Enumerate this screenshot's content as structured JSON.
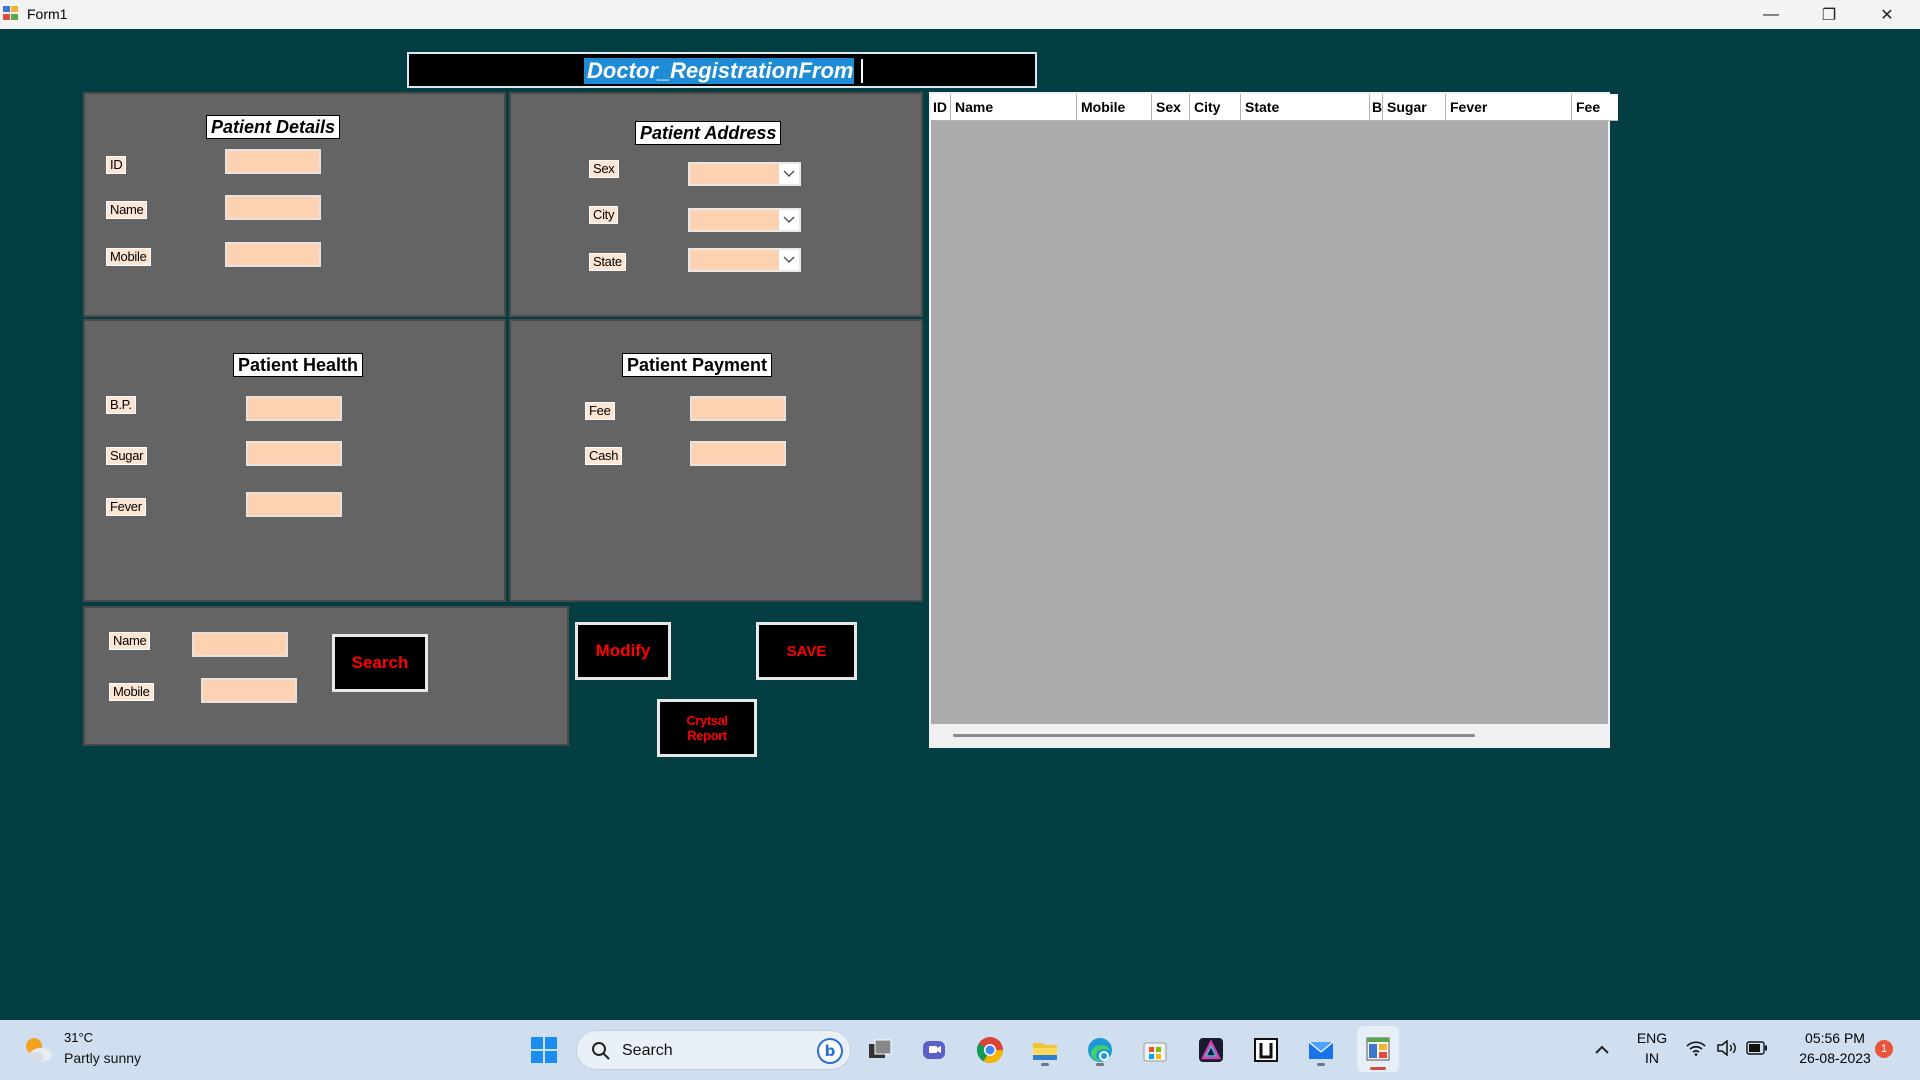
{
  "window": {
    "title": "Form1",
    "minimize": "—",
    "restore": "❐",
    "close": "✕"
  },
  "form": {
    "heading": "Doctor_RegistrationFrom"
  },
  "patient_details": {
    "title": "Patient Details",
    "id_label": "ID",
    "name_label": "Name",
    "mobile_label": "Mobile"
  },
  "patient_address": {
    "title": "Patient Address",
    "sex_label": "Sex",
    "city_label": "City",
    "state_label": "State"
  },
  "patient_health": {
    "title": "Patient Health",
    "bp_label": "B.P.",
    "sugar_label": "Sugar",
    "fever_label": "Fever"
  },
  "patient_payment": {
    "title": "Patient Payment",
    "fee_label": "Fee",
    "cash_label": "Cash"
  },
  "search_panel": {
    "name_label": "Name",
    "mobile_label": "Mobile",
    "search_button": "Search"
  },
  "buttons": {
    "modify": "Modify",
    "save": "SAVE",
    "report": "Crytsal Report"
  },
  "grid": {
    "columns": [
      "ID",
      "Name",
      "Mobile",
      "Sex",
      "City",
      "State",
      "BP",
      "Sugar",
      "Fever",
      "Fee"
    ]
  },
  "taskbar": {
    "temperature": "31°C",
    "weather": "Partly sunny",
    "search_placeholder": "Search",
    "language": "ENG",
    "region": "IN",
    "time": "05:56 PM",
    "date": "26-08-2023",
    "notification_count": "1",
    "icons": [
      "start-icon",
      "search-icon",
      "bing-icon",
      "task-view-icon",
      "teams-icon",
      "chrome-icon",
      "file-explorer-icon",
      "edge-icon",
      "store-icon",
      "affinity-icon",
      "app-icon",
      "mail-icon",
      "winforms-app-icon",
      "wifi-icon",
      "volume-icon",
      "battery-icon"
    ]
  }
}
